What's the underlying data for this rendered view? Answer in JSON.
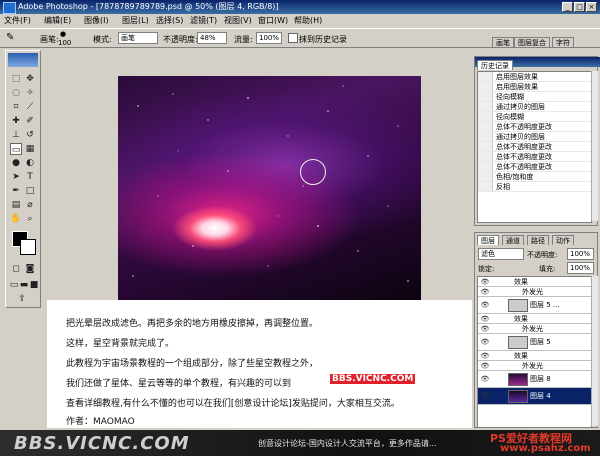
{
  "window": {
    "title": "Adobe Photoshop - [7878789789789.psd @ 50% (图层 4, RGB/8)]"
  },
  "menu": [
    "文件(F)",
    "编辑(E)",
    "图像(I)",
    "图层(L)",
    "选择(S)",
    "滤镜(T)",
    "视图(V)",
    "窗口(W)",
    "帮助(H)"
  ],
  "options": {
    "brush_label": "画笔:",
    "brush_size": "100",
    "mode_label": "模式:",
    "mode_value": "画笔",
    "opacity_label": "不透明度:",
    "opacity_value": "48%",
    "flow_label": "流量:",
    "flow_value": "100%",
    "erase_history_label": "抹到历史记录"
  },
  "top_tabs": [
    "画笔",
    "图层复合",
    "字符"
  ],
  "history": {
    "tab": "历史记录",
    "items": [
      "启用图层效果",
      "启用图层效果",
      "径向模糊",
      "通过拷贝的图层",
      "径向模糊",
      "总体不透明度更改",
      "通过拷贝的图层",
      "总体不透明度更改",
      "总体不透明度更改",
      "总体不透明度更改",
      "色相/饱和度",
      "反相"
    ]
  },
  "layers_panel": {
    "tabs": [
      "图层",
      "通道",
      "路径",
      "动作"
    ],
    "blend_mode": "滤色",
    "opacity_label": "不透明度:",
    "opacity_value": "100%",
    "lock_label": "锁定:",
    "fill_label": "填充:",
    "fill_value": "100%",
    "layers": [
      {
        "kind": "effect",
        "name": "效果"
      },
      {
        "kind": "effect",
        "name": "外发光"
      },
      {
        "kind": "layer",
        "name": "图层 5 ..."
      },
      {
        "kind": "effect",
        "name": "效果"
      },
      {
        "kind": "effect",
        "name": "外发光"
      },
      {
        "kind": "layer",
        "name": "图层 5"
      },
      {
        "kind": "effect",
        "name": "效果"
      },
      {
        "kind": "effect",
        "name": "外发光"
      },
      {
        "kind": "layer",
        "name": "图层 8"
      },
      {
        "kind": "layer",
        "name": "图层 4",
        "selected": true
      }
    ]
  },
  "caption": {
    "line1": "把光晕层改成滤色。再把多余的地方用橡皮擦掉，再调整位置。",
    "line2": "这样，星空背景就完成了。",
    "line3": "此教程为宇宙场景教程的一个组成部分，除了些星空教程之外，",
    "line4": "我们还做了星体、星云等等的单个教程，有兴趣的可以到",
    "line4_link": "BBS.VICNC.COM",
    "line5": "查看详细教程,有什么不懂的也可以在我们[创意设计论坛]发贴提问，大家相互交流。",
    "line6": "作者：MAOMAO"
  },
  "footer": {
    "logo": "BBS.VICNC.COM",
    "slogan": "创意设计论坛-国内设计人交流平台，更多作品请...",
    "watermark1": "PS爱好者教程网",
    "watermark2": "www.psahz.com"
  },
  "colors": {
    "title_blue": "#0a246a",
    "link_red": "#e0202a",
    "watermark_red": "#e23a2a"
  }
}
